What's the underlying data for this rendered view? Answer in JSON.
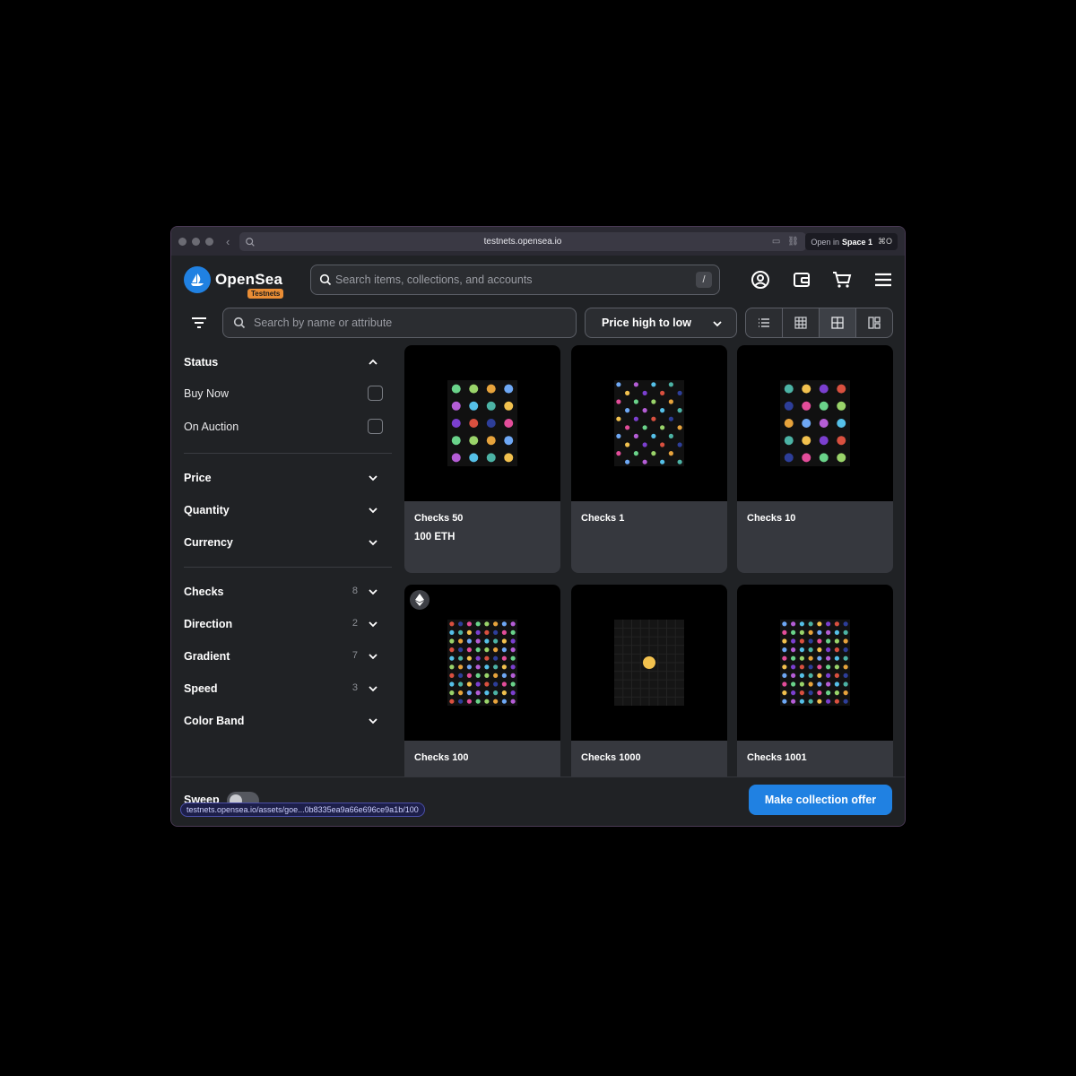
{
  "browser": {
    "url": "testnets.opensea.io",
    "open_in_prefix": "Open in",
    "open_in_space": "Space 1",
    "open_in_shortcut": "⌘O",
    "status_url": "testnets.opensea.io/assets/goe...0b8335ea9a66e696ce9a1b/100"
  },
  "header": {
    "brand": "OpenSea",
    "badge": "Testnets",
    "search_placeholder": "Search items, collections, and accounts",
    "search_shortcut": "/"
  },
  "toolbar": {
    "attribute_search_placeholder": "Search by name or attribute",
    "sort_label": "Price high to low"
  },
  "sidebar": {
    "status": {
      "title": "Status",
      "options": [
        {
          "label": "Buy Now",
          "checked": false
        },
        {
          "label": "On Auction",
          "checked": false
        }
      ]
    },
    "filters": [
      {
        "label": "Price"
      },
      {
        "label": "Quantity"
      },
      {
        "label": "Currency"
      }
    ],
    "traits": [
      {
        "label": "Checks",
        "count": "8"
      },
      {
        "label": "Direction",
        "count": "2"
      },
      {
        "label": "Gradient",
        "count": "7"
      },
      {
        "label": "Speed",
        "count": "3"
      },
      {
        "label": "Color Band",
        "count": ""
      }
    ]
  },
  "items": [
    {
      "name": "Checks 50",
      "price": "100 ETH",
      "grid": 4
    },
    {
      "name": "Checks 1",
      "price": "",
      "grid": 8
    },
    {
      "name": "Checks 10",
      "price": "",
      "grid": 4
    },
    {
      "name": "Checks 100",
      "price": "",
      "grid": 8
    },
    {
      "name": "Checks 1000",
      "price": "",
      "grid": 1
    },
    {
      "name": "Checks 1001",
      "price": "",
      "grid": 8
    }
  ],
  "footer": {
    "sweep_label": "Sweep",
    "offer_button": "Make collection offer"
  },
  "colors": {
    "accent": "#2081e2",
    "badge": "#e98d35",
    "check_palette": [
      "#6ea8f5",
      "#2d3e99",
      "#55c0e8",
      "#6ad38a",
      "#f2c14e",
      "#e7a33c",
      "#d9503f",
      "#b55dd6",
      "#e34d9a",
      "#4cb3a5",
      "#9ad46a",
      "#7b3fcf"
    ]
  }
}
